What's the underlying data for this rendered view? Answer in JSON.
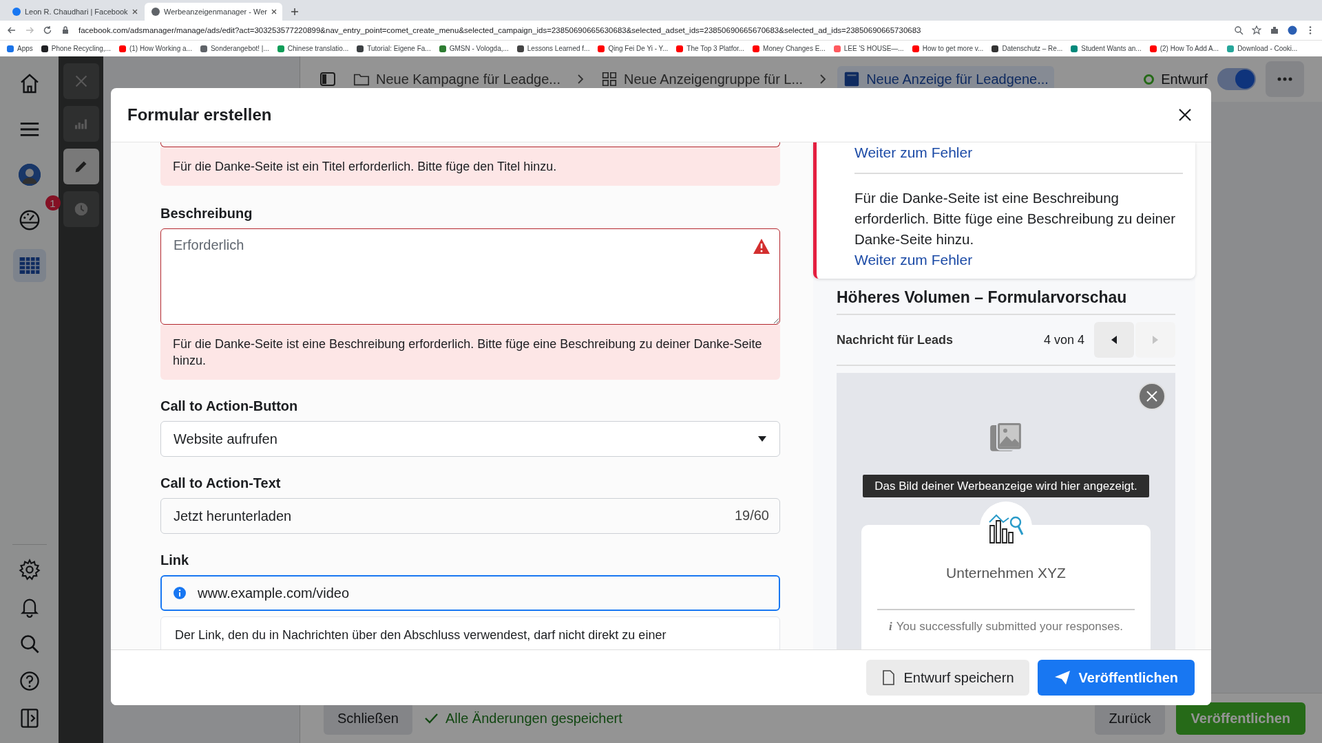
{
  "browser": {
    "tabs": [
      {
        "title": "Leon R. Chaudhari | Facebook",
        "selected": false
      },
      {
        "title": "Werbeanzeigenmanager - Wer",
        "selected": true
      }
    ],
    "url": "facebook.com/adsmanager/manage/ads/edit?act=303253577220899&nav_entry_point=comet_create_menu&selected_campaign_ids=23850690665630683&selected_adset_ids=23850690665670683&selected_ad_ids=23850690665730683",
    "bookmarks": [
      {
        "label": "Apps",
        "color": "#1a73e8"
      },
      {
        "label": "Phone Recycling,...",
        "color": "#202124"
      },
      {
        "label": "(1) How Working a...",
        "color": "#ff0000"
      },
      {
        "label": "Sonderangebot! |...",
        "color": "#5f6368"
      },
      {
        "label": "Chinese translatio...",
        "color": "#0f9d58"
      },
      {
        "label": "Tutorial: Eigene Fa...",
        "color": "#3c4043"
      },
      {
        "label": "GMSN - Vologda,...",
        "color": "#2e7d32"
      },
      {
        "label": "Lessons Learned f...",
        "color": "#444444"
      },
      {
        "label": "Qing Fei De Yi - Y...",
        "color": "#ff0000"
      },
      {
        "label": "The Top 3 Platfor...",
        "color": "#ff0000"
      },
      {
        "label": "Money Changes E...",
        "color": "#ff0000"
      },
      {
        "label": "LEE 'S HOUSE—...",
        "color": "#ff5a5f"
      },
      {
        "label": "How to get more v...",
        "color": "#ff0000"
      },
      {
        "label": "Datenschutz – Re...",
        "color": "#333333"
      },
      {
        "label": "Student Wants an...",
        "color": "#00897b"
      },
      {
        "label": "(2) How To Add A...",
        "color": "#ff0000"
      },
      {
        "label": "Download - Cooki...",
        "color": "#26a69a"
      }
    ]
  },
  "rail": {
    "items": [
      {
        "kind": "home",
        "selected": false
      },
      {
        "kind": "menu",
        "selected": false
      },
      {
        "kind": "avatar",
        "selected": false
      },
      {
        "kind": "gauge",
        "selected": false,
        "badge": "1"
      },
      {
        "kind": "table",
        "selected": true
      }
    ],
    "bottom_items": [
      {
        "kind": "gear"
      },
      {
        "kind": "bell"
      },
      {
        "kind": "search"
      },
      {
        "kind": "help"
      },
      {
        "kind": "panel"
      }
    ]
  },
  "editor_nav": [
    {
      "kind": "close",
      "selected": false
    },
    {
      "kind": "chart",
      "selected": false
    },
    {
      "kind": "pencil",
      "selected": true
    },
    {
      "kind": "clock",
      "selected": false
    }
  ],
  "breadcrumb": [
    {
      "kind": "folder",
      "label": "Neue Kampagne für Leadge...",
      "selected": false
    },
    {
      "kind": "grid",
      "label": "Neue Anzeigengruppe für L...",
      "selected": false
    },
    {
      "kind": "ad",
      "label": "Neue Anzeige für Leadgene...",
      "selected": true
    }
  ],
  "status": {
    "label": "Entwurf",
    "toggle_on": true
  },
  "bottom_bar": {
    "close": "Schließen",
    "saved": "Alle Änderungen gespeichert",
    "back": "Zurück",
    "publish": "Veröffentlichen"
  },
  "modal": {
    "title": "Formular erstellen",
    "title_error": "Für die Danke-Seite ist ein Titel erforderlich. Bitte füge den Titel hinzu.",
    "description": {
      "label": "Beschreibung",
      "placeholder": "Erforderlich",
      "error": true,
      "message": "Für die Danke-Seite ist eine Beschreibung erforderlich. Bitte füge eine Beschreibung zu deiner Danke-Seite hinzu."
    },
    "cta_button": {
      "label": "Call to Action-Button",
      "value": "Website aufrufen"
    },
    "cta_text": {
      "label": "Call to Action-Text",
      "value": "Jetzt herunterladen",
      "count": "19/60"
    },
    "link": {
      "label": "Link",
      "value": "www.example.com/video",
      "focused": true,
      "note": "Der Link, den du in Nachrichten über den Abschluss verwendest, darf nicht direkt zu einer"
    },
    "errors": [
      {
        "link": "Weiter zum Fehler"
      },
      {
        "text": "Für die Danke-Seite ist eine Beschreibung erforderlich. Bitte füge eine Beschreibung zu deiner Danke-Seite hinzu.",
        "link": "Weiter zum Fehler"
      }
    ],
    "preview": {
      "title": "Höheres Volumen – Formularvorschau",
      "step": "Nachricht für Leads",
      "counter": "4 von 4",
      "nav": [
        {
          "kind": "prev",
          "disabled": false
        },
        {
          "kind": "next",
          "disabled": true
        }
      ],
      "image_hint": "Das Bild deiner Werbeanzeige wird hier angezeigt.",
      "company": "Unternehmen XYZ",
      "info_icon": "i",
      "success": "You successfully submitted your responses."
    },
    "footer": {
      "save": "Entwurf speichern",
      "publish": "Veröffentlichen"
    }
  }
}
